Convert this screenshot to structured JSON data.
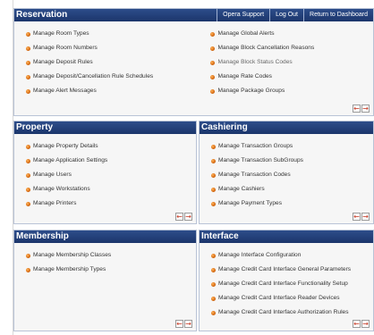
{
  "nav": {
    "opera_support": "Opera Support",
    "log_out": "Log Out",
    "return_dashboard": "Return to Dashboard"
  },
  "arrows": {
    "prev": "←",
    "next": "→"
  },
  "reservation": {
    "title": "Reservation",
    "left_items": [
      "Manage Room Types",
      "Manage Room Numbers",
      "Manage Deposit Rules",
      "Manage Deposit/Cancellation Rule Schedules",
      "Manage Alert Messages"
    ],
    "right_items": [
      "Manage Global Alerts",
      "Manage Block Cancellation Reasons",
      "Manage Block Status Codes",
      "Manage Rate Codes",
      "Manage Package Groups"
    ]
  },
  "property": {
    "title": "Property",
    "items": [
      "Manage Property Details",
      "Manage Application Settings",
      "Manage Users",
      "Manage Workstations",
      "Manage Printers"
    ]
  },
  "cashiering": {
    "title": "Cashiering",
    "items": [
      "Manage Transaction Groups",
      "Manage Transaction SubGroups",
      "Manage Transaction Codes",
      "Manage Cashiers",
      "Manage Payment Types"
    ]
  },
  "membership": {
    "title": "Membership",
    "items": [
      "Manage Membership Classes",
      "Manage Membership Types"
    ]
  },
  "interface": {
    "title": "Interface",
    "items": [
      "Manage Interface Configuration",
      "Manage Credit Card Interface General Parameters",
      "Manage Credit Card Interface Functionality Setup",
      "Manage Credit Card Interface Reader Devices",
      "Manage Credit Card Interface Authorization Rules"
    ]
  }
}
